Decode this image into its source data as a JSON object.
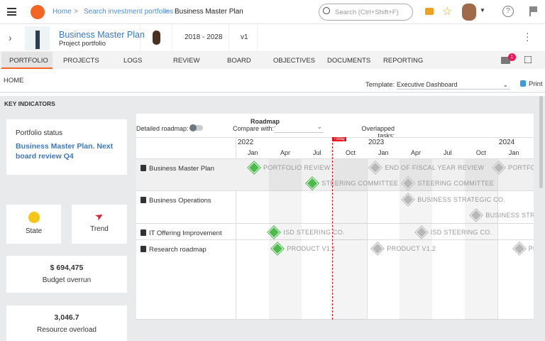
{
  "topbar": {
    "breadcrumb": [
      "Home",
      "Search investment portfolios",
      "Business Master Plan"
    ],
    "search_placeholder": "Search (Ctrl+Shift+F)",
    "brand_color": "#f26522"
  },
  "header": {
    "title": "Business Master Plan",
    "subtitle": "Project portfolio",
    "period": "2018 - 2028",
    "version": "v1"
  },
  "tabs": [
    "PORTFOLIO",
    "PROJECTS",
    "LOGS",
    "REVIEW",
    "BOARD",
    "OBJECTIVES",
    "DOCUMENTS",
    "REPORTING"
  ],
  "active_tab": "PORTFOLIO",
  "notifications_count": "1",
  "page": {
    "section": "HOME",
    "template_label": "Template:",
    "template_value": "Executive Dashboard",
    "print": "Print",
    "key_indicators": "KEY INDICATORS"
  },
  "indicators": {
    "status_title": "Portfolio status",
    "status_text": "Business Master Plan. Next board review Q4",
    "state": "State",
    "state_color": "#f5c518",
    "trend": "Trend",
    "trend_color": "#e0202a",
    "budget_value": "$ 694,475",
    "budget_label": "Budget overrun",
    "resource_value": "3,046.7",
    "resource_label": "Resource overload"
  },
  "roadmap": {
    "title": "Roadmap",
    "detailed_label": "Detailed roadmap:",
    "detailed_on": false,
    "compare_label": "Compare with:",
    "compare_value": "-",
    "overlapped_label": "Overlapped tasks:",
    "today_label": "Today",
    "today": "2022-09-25",
    "years": [
      "2022",
      "2023",
      "2024"
    ],
    "quarters": [
      "Jan",
      "Apr",
      "Jul",
      "Oct",
      "Jan",
      "Apr",
      "Jul",
      "Oct",
      "Jan"
    ],
    "rows": [
      {
        "name": "Business  Master  Plan",
        "milestones": [
          {
            "label": "PORTFOLIO REVIEW",
            "date": "2022-02-20",
            "done": true,
            "lane": 0
          },
          {
            "label": "STEERING COMMITTEE",
            "date": "2022-08-01",
            "done": true,
            "lane": 1
          },
          {
            "label": "END OF FISCAL YEAR REVIEW",
            "date": "2023-01-25",
            "done": false,
            "lane": 0
          },
          {
            "label": "STEERING COMMITTEE",
            "date": "2023-04-25",
            "done": false,
            "lane": 1
          },
          {
            "label": "PORTFOLIO REVIEW",
            "date": "2024-01-05",
            "done": false,
            "lane": 0
          }
        ]
      },
      {
        "name": "Business Operations",
        "milestones": [
          {
            "label": "BUSINESS STRATEGIC CO.",
            "date": "2023-04-25",
            "done": false,
            "lane": 0
          },
          {
            "label": "BUSINESS STRATEGIC CO.",
            "date": "2023-11-03",
            "done": false,
            "lane": 1
          }
        ]
      },
      {
        "name": "IT Offering Improvement",
        "milestones": [
          {
            "label": "ISD STEERING CO.",
            "date": "2022-04-15",
            "done": true,
            "lane": 0
          },
          {
            "label": "ISD STEERING CO.",
            "date": "2023-06-01",
            "done": false,
            "lane": 0
          }
        ]
      },
      {
        "name": "Research roadmap",
        "milestones": [
          {
            "label": "PRODUCT V1.1",
            "date": "2022-04-25",
            "done": true,
            "lane": 0
          },
          {
            "label": "PRODUCT V1.2",
            "date": "2023-02-01",
            "done": false,
            "lane": 0
          },
          {
            "label": "PRODUCT",
            "date": "2024-03-01",
            "done": false,
            "lane": 0
          }
        ]
      }
    ],
    "done_color": "#4cba4c",
    "pending_color": "#b8b8b8",
    "today_color": "#e8121f"
  }
}
